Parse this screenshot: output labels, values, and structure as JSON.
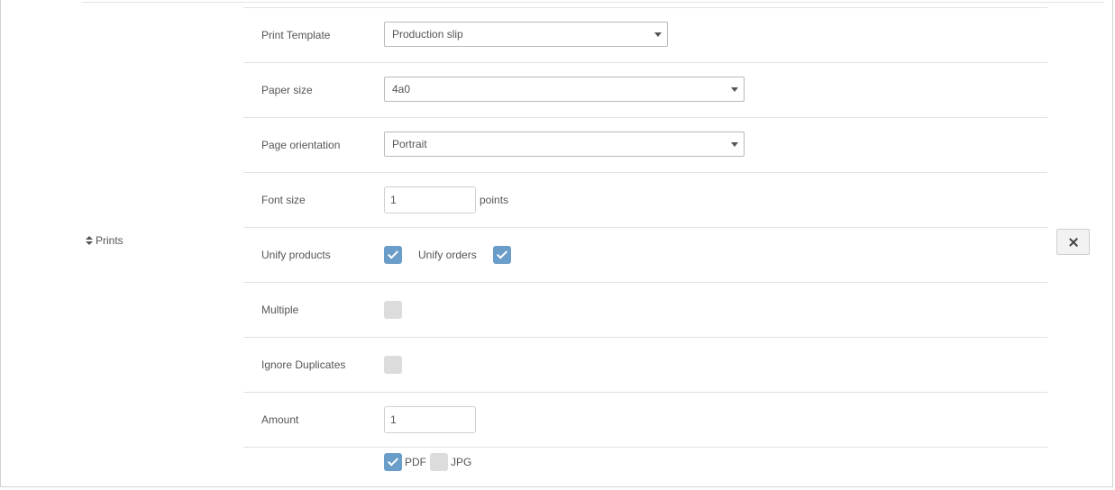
{
  "section": {
    "label": "Prints",
    "icon": "sort-icon"
  },
  "rows": {
    "print_template": {
      "label": "Print Template",
      "value": "Production slip"
    },
    "paper_size": {
      "label": "Paper size",
      "value": "4a0"
    },
    "page_orientation": {
      "label": "Page orientation",
      "value": "Portrait"
    },
    "font_size": {
      "label": "Font size",
      "value": "1",
      "unit": "points"
    },
    "unify": {
      "label": "Unify products",
      "products_checked": true,
      "orders_label": "Unify orders",
      "orders_checked": true
    },
    "multiple": {
      "label": "Multiple",
      "checked": false
    },
    "ignore_duplicates": {
      "label": "Ignore Duplicates",
      "checked": false
    },
    "amount": {
      "label": "Amount",
      "value": "1"
    }
  },
  "formats": {
    "pdf": {
      "label": "PDF",
      "checked": true
    },
    "jpg": {
      "label": "JPG",
      "checked": false
    }
  },
  "remove_button": {
    "icon": "close-icon"
  },
  "colors": {
    "checkbox_on": "#6a9ec9",
    "checkbox_off": "#dcdcdc",
    "divider": "#e2e2e2"
  }
}
